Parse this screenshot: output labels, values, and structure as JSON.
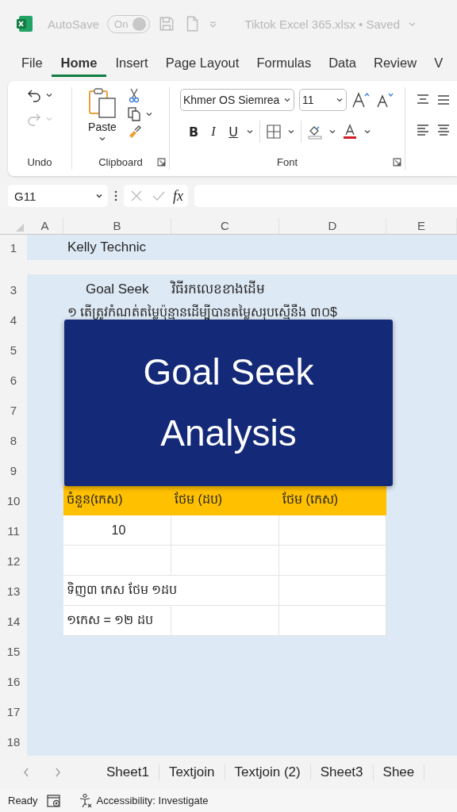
{
  "title_bar": {
    "autosave": "AutoSave",
    "toggle": {
      "label": "On",
      "on": true,
      "disabled": true
    },
    "title": "Tiktok Excel 365.xlsx • Saved"
  },
  "ribbon_tabs": [
    {
      "label": "File",
      "selected": false
    },
    {
      "label": "Home",
      "selected": true
    },
    {
      "label": "Insert",
      "selected": false
    },
    {
      "label": "Page Layout",
      "selected": false
    },
    {
      "label": "Formulas",
      "selected": false
    },
    {
      "label": "Data",
      "selected": false
    },
    {
      "label": "Review",
      "selected": false
    },
    {
      "label": "V",
      "selected": false
    }
  ],
  "ribbon": {
    "undo_group": "Undo",
    "clipboard_group": "Clipboard",
    "paste": "Paste",
    "font_group": "Font",
    "font_name": "Khmer OS Siemrea",
    "font_size": "11",
    "bold": "B",
    "italic": "I",
    "underline": "U"
  },
  "formula_bar": {
    "name_box": "G11",
    "fx": "fx"
  },
  "columns": [
    "A",
    "B",
    "C",
    "D",
    "E"
  ],
  "rows": [
    {
      "number": "1",
      "kind": "title",
      "texts": [
        "Kelly Technic"
      ]
    },
    {
      "number": "3",
      "kind": "heading",
      "texts": [
        "Goal Seek",
        "វិធីរកលេខខាងដើម"
      ]
    },
    {
      "number": "4",
      "kind": "note",
      "texts": [
        "១  តើត្រូវកំណត់តម្លៃប៉ុន្មានដើម្បីបានតម្លៃសរុបស្មើនឹង ៣០$"
      ]
    },
    {
      "number": "5",
      "kind": "blank"
    },
    {
      "number": "6",
      "kind": "blank"
    },
    {
      "number": "7",
      "kind": "blank"
    },
    {
      "number": "8",
      "kind": "blank"
    },
    {
      "number": "9",
      "kind": "blank"
    },
    {
      "number": "10",
      "kind": "table_header",
      "texts": [
        "ចំនួន(កេស)",
        "ថែម (ដប)",
        "ថែម (កេស)"
      ]
    },
    {
      "number": "11",
      "kind": "table_number",
      "texts": [
        "10"
      ]
    },
    {
      "number": "12",
      "kind": "table_empty"
    },
    {
      "number": "13",
      "kind": "table_merged",
      "texts": [
        "ទិញ៣ កេស ថែម ១ដប"
      ]
    },
    {
      "number": "14",
      "kind": "table_label",
      "texts": [
        "១កេស = ១២ ដប"
      ]
    },
    {
      "number": "15",
      "kind": "blank"
    },
    {
      "number": "16",
      "kind": "blank"
    },
    {
      "number": "17",
      "kind": "blank"
    },
    {
      "number": "18",
      "kind": "blank"
    }
  ],
  "overlay": {
    "lines": [
      "Goal Seek",
      "Analysis"
    ]
  },
  "sheet_tabs": [
    "Sheet1",
    "Textjoin",
    "Textjoin (2)",
    "Sheet3",
    "Shee"
  ],
  "status_bar": {
    "ready": "Ready",
    "accessibility": "Accessibility: Investigate"
  }
}
